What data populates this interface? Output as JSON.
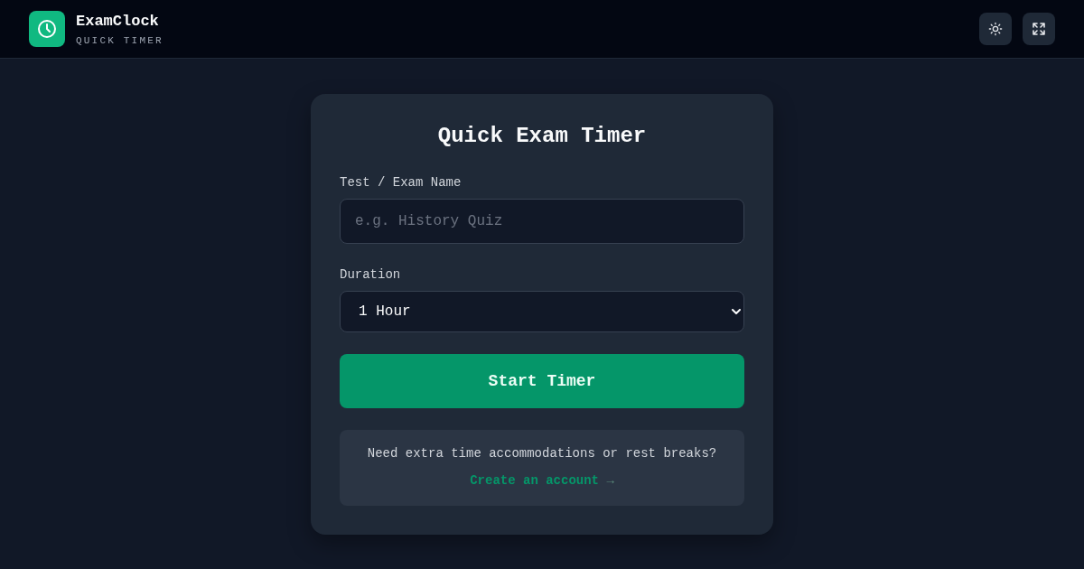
{
  "header": {
    "app_name": "ExamClock",
    "tagline": "QUICK TIMER",
    "actions": [
      {
        "kind": "theme"
      },
      {
        "kind": "fullscreen"
      }
    ]
  },
  "card": {
    "title": "Quick Exam Timer",
    "fields": [
      {
        "kind": "text",
        "label": "Test / Exam Name",
        "placeholder": "e.g. History Quiz"
      },
      {
        "kind": "select",
        "label": "Duration",
        "value": "1 Hour"
      }
    ],
    "submit_button": "Start Timer",
    "notice": {
      "text": "Need extra time accommodations or rest breaks?",
      "link": {
        "label": "Create an account",
        "arrow": "→"
      }
    }
  }
}
